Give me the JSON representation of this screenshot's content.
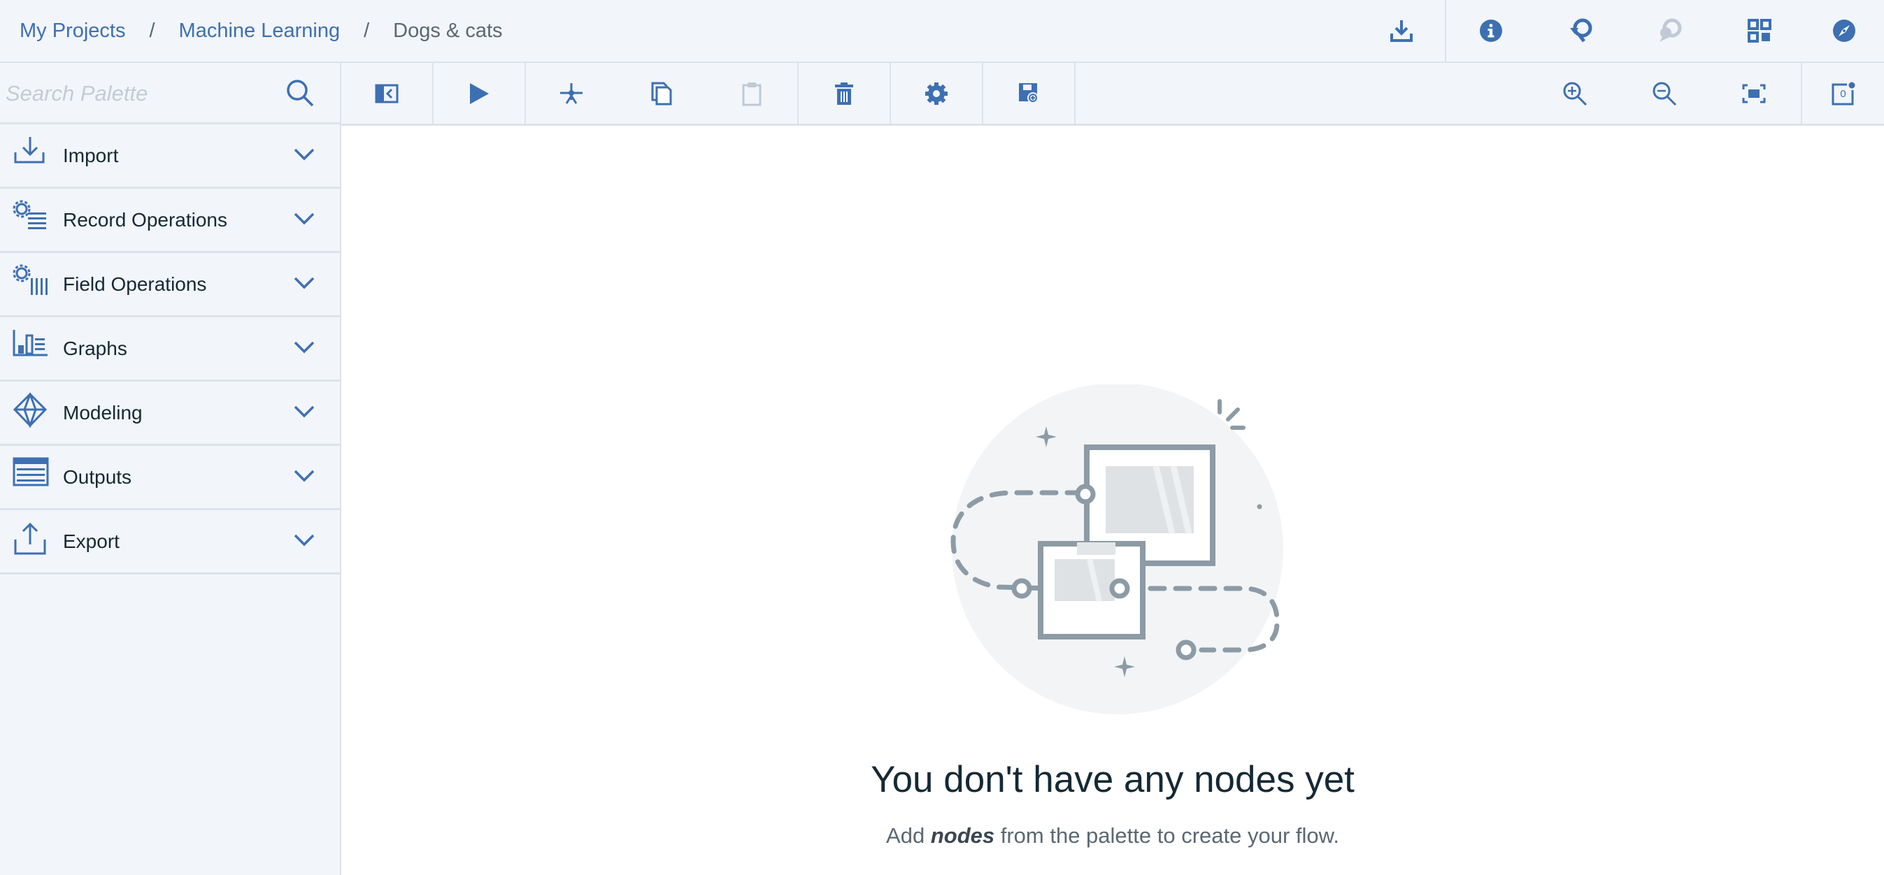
{
  "breadcrumb": {
    "items": [
      "My Projects",
      "Machine Learning"
    ],
    "separator": "/",
    "current": "Dogs & cats"
  },
  "header_actions": [
    {
      "icon": "download-icon",
      "enabled": true
    },
    {
      "icon": "info-icon",
      "enabled": true
    },
    {
      "icon": "history-icon",
      "enabled": true
    },
    {
      "icon": "comments-icon",
      "enabled": false
    },
    {
      "icon": "grid-layout-icon",
      "enabled": true
    },
    {
      "icon": "compass-icon",
      "enabled": true
    }
  ],
  "search": {
    "placeholder": "Search Palette",
    "value": ""
  },
  "palette": {
    "categories": [
      {
        "label": "Import",
        "icon": "import-icon"
      },
      {
        "label": "Record Operations",
        "icon": "record-operations-icon"
      },
      {
        "label": "Field Operations",
        "icon": "field-operations-icon"
      },
      {
        "label": "Graphs",
        "icon": "graphs-icon"
      },
      {
        "label": "Modeling",
        "icon": "modeling-icon"
      },
      {
        "label": "Outputs",
        "icon": "outputs-icon"
      },
      {
        "label": "Export",
        "icon": "export-icon"
      }
    ]
  },
  "toolbar": {
    "tools": [
      {
        "icon": "toggle-palette-icon",
        "enabled": true
      },
      {
        "icon": "run-icon",
        "enabled": true
      },
      {
        "icon": "cut-icon",
        "enabled": true
      },
      {
        "icon": "copy-icon",
        "enabled": true
      },
      {
        "icon": "paste-icon",
        "enabled": false
      },
      {
        "icon": "delete-icon",
        "enabled": true
      },
      {
        "icon": "settings-icon",
        "enabled": true
      },
      {
        "icon": "save-icon",
        "enabled": true
      },
      {
        "icon": "zoom-in-icon",
        "enabled": true
      },
      {
        "icon": "zoom-out-icon",
        "enabled": true
      },
      {
        "icon": "fit-to-screen-icon",
        "enabled": true
      },
      {
        "icon": "notifications-icon",
        "enabled": true,
        "count": "0"
      }
    ]
  },
  "empty_state": {
    "title": "You don't have any nodes yet",
    "sub_before": "Add ",
    "sub_emphasis": "nodes",
    "sub_after": " from the palette to create your flow."
  },
  "colors": {
    "accent": "#3d70b2",
    "panel_bg": "#f2f5fa",
    "border": "#dde3ec",
    "disabled": "#c0cad6",
    "text": "#152935"
  }
}
